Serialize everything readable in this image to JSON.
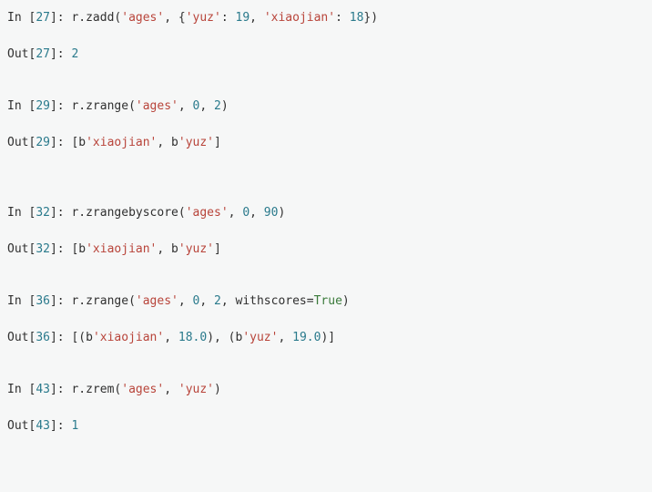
{
  "cells": [
    {
      "in_num": "27",
      "code": "r.zadd('ages', {'yuz': 19, 'xiaojian': 18})",
      "out_num": "27",
      "output": "2"
    },
    {
      "in_num": "29",
      "code": "r.zrange('ages', 0, 2)",
      "out_num": "29",
      "output": "[b'xiaojian', b'yuz']"
    },
    {
      "in_num": "32",
      "code": "r.zrangebyscore('ages', 0, 90)",
      "out_num": "32",
      "output": "[b'xiaojian', b'yuz']"
    },
    {
      "in_num": "36",
      "code": "r.zrange('ages', 0, 2, withscores=True)",
      "out_num": "36",
      "output": "[(b'xiaojian', 18.0), (b'yuz', 19.0)]"
    },
    {
      "in_num": "43",
      "code": "r.zrem('ages', 'yuz')",
      "out_num": "43",
      "output": "1"
    }
  ]
}
